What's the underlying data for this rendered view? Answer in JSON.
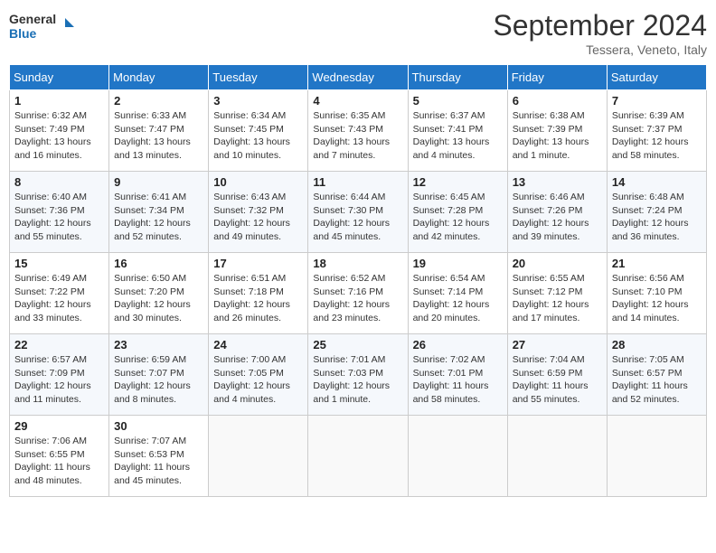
{
  "header": {
    "logo_line1": "General",
    "logo_line2": "Blue",
    "month": "September 2024",
    "location": "Tessera, Veneto, Italy"
  },
  "days_of_week": [
    "Sunday",
    "Monday",
    "Tuesday",
    "Wednesday",
    "Thursday",
    "Friday",
    "Saturday"
  ],
  "weeks": [
    [
      {
        "day": "1",
        "info": "Sunrise: 6:32 AM\nSunset: 7:49 PM\nDaylight: 13 hours\nand 16 minutes."
      },
      {
        "day": "2",
        "info": "Sunrise: 6:33 AM\nSunset: 7:47 PM\nDaylight: 13 hours\nand 13 minutes."
      },
      {
        "day": "3",
        "info": "Sunrise: 6:34 AM\nSunset: 7:45 PM\nDaylight: 13 hours\nand 10 minutes."
      },
      {
        "day": "4",
        "info": "Sunrise: 6:35 AM\nSunset: 7:43 PM\nDaylight: 13 hours\nand 7 minutes."
      },
      {
        "day": "5",
        "info": "Sunrise: 6:37 AM\nSunset: 7:41 PM\nDaylight: 13 hours\nand 4 minutes."
      },
      {
        "day": "6",
        "info": "Sunrise: 6:38 AM\nSunset: 7:39 PM\nDaylight: 13 hours\nand 1 minute."
      },
      {
        "day": "7",
        "info": "Sunrise: 6:39 AM\nSunset: 7:37 PM\nDaylight: 12 hours\nand 58 minutes."
      }
    ],
    [
      {
        "day": "8",
        "info": "Sunrise: 6:40 AM\nSunset: 7:36 PM\nDaylight: 12 hours\nand 55 minutes."
      },
      {
        "day": "9",
        "info": "Sunrise: 6:41 AM\nSunset: 7:34 PM\nDaylight: 12 hours\nand 52 minutes."
      },
      {
        "day": "10",
        "info": "Sunrise: 6:43 AM\nSunset: 7:32 PM\nDaylight: 12 hours\nand 49 minutes."
      },
      {
        "day": "11",
        "info": "Sunrise: 6:44 AM\nSunset: 7:30 PM\nDaylight: 12 hours\nand 45 minutes."
      },
      {
        "day": "12",
        "info": "Sunrise: 6:45 AM\nSunset: 7:28 PM\nDaylight: 12 hours\nand 42 minutes."
      },
      {
        "day": "13",
        "info": "Sunrise: 6:46 AM\nSunset: 7:26 PM\nDaylight: 12 hours\nand 39 minutes."
      },
      {
        "day": "14",
        "info": "Sunrise: 6:48 AM\nSunset: 7:24 PM\nDaylight: 12 hours\nand 36 minutes."
      }
    ],
    [
      {
        "day": "15",
        "info": "Sunrise: 6:49 AM\nSunset: 7:22 PM\nDaylight: 12 hours\nand 33 minutes."
      },
      {
        "day": "16",
        "info": "Sunrise: 6:50 AM\nSunset: 7:20 PM\nDaylight: 12 hours\nand 30 minutes."
      },
      {
        "day": "17",
        "info": "Sunrise: 6:51 AM\nSunset: 7:18 PM\nDaylight: 12 hours\nand 26 minutes."
      },
      {
        "day": "18",
        "info": "Sunrise: 6:52 AM\nSunset: 7:16 PM\nDaylight: 12 hours\nand 23 minutes."
      },
      {
        "day": "19",
        "info": "Sunrise: 6:54 AM\nSunset: 7:14 PM\nDaylight: 12 hours\nand 20 minutes."
      },
      {
        "day": "20",
        "info": "Sunrise: 6:55 AM\nSunset: 7:12 PM\nDaylight: 12 hours\nand 17 minutes."
      },
      {
        "day": "21",
        "info": "Sunrise: 6:56 AM\nSunset: 7:10 PM\nDaylight: 12 hours\nand 14 minutes."
      }
    ],
    [
      {
        "day": "22",
        "info": "Sunrise: 6:57 AM\nSunset: 7:09 PM\nDaylight: 12 hours\nand 11 minutes."
      },
      {
        "day": "23",
        "info": "Sunrise: 6:59 AM\nSunset: 7:07 PM\nDaylight: 12 hours\nand 8 minutes."
      },
      {
        "day": "24",
        "info": "Sunrise: 7:00 AM\nSunset: 7:05 PM\nDaylight: 12 hours\nand 4 minutes."
      },
      {
        "day": "25",
        "info": "Sunrise: 7:01 AM\nSunset: 7:03 PM\nDaylight: 12 hours\nand 1 minute."
      },
      {
        "day": "26",
        "info": "Sunrise: 7:02 AM\nSunset: 7:01 PM\nDaylight: 11 hours\nand 58 minutes."
      },
      {
        "day": "27",
        "info": "Sunrise: 7:04 AM\nSunset: 6:59 PM\nDaylight: 11 hours\nand 55 minutes."
      },
      {
        "day": "28",
        "info": "Sunrise: 7:05 AM\nSunset: 6:57 PM\nDaylight: 11 hours\nand 52 minutes."
      }
    ],
    [
      {
        "day": "29",
        "info": "Sunrise: 7:06 AM\nSunset: 6:55 PM\nDaylight: 11 hours\nand 48 minutes."
      },
      {
        "day": "30",
        "info": "Sunrise: 7:07 AM\nSunset: 6:53 PM\nDaylight: 11 hours\nand 45 minutes."
      },
      {
        "day": "",
        "info": ""
      },
      {
        "day": "",
        "info": ""
      },
      {
        "day": "",
        "info": ""
      },
      {
        "day": "",
        "info": ""
      },
      {
        "day": "",
        "info": ""
      }
    ]
  ]
}
